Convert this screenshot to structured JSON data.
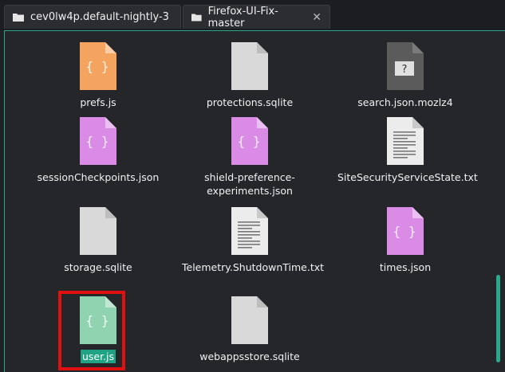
{
  "tabs": [
    {
      "label": "cev0lw4p.default-nightly-3",
      "active": true
    },
    {
      "label": "Firefox-UI-Fix-master",
      "active": false,
      "close": "✕"
    }
  ],
  "files": [
    {
      "name": "prefs.js",
      "type": "js-orange",
      "icon": "braces-file-icon"
    },
    {
      "name": "protections.sqlite",
      "type": "blank",
      "icon": "blank-file-icon"
    },
    {
      "name": "search.json.mozlz4",
      "type": "unknown",
      "icon": "unknown-file-icon"
    },
    {
      "name": "sessionCheckpoints.json",
      "type": "json-purple",
      "icon": "braces-file-icon"
    },
    {
      "name": "shield-preference-experiments.json",
      "type": "json-purple",
      "icon": "braces-file-icon"
    },
    {
      "name": "SiteSecurityServiceState.txt",
      "type": "text",
      "icon": "text-file-icon"
    },
    {
      "name": "storage.sqlite",
      "type": "blank",
      "icon": "blank-file-icon"
    },
    {
      "name": "Telemetry.ShutdownTime.txt",
      "type": "text",
      "icon": "text-file-icon"
    },
    {
      "name": "times.json",
      "type": "json-purple",
      "icon": "braces-file-icon"
    },
    {
      "name": "user.js",
      "type": "js-green",
      "icon": "braces-file-icon",
      "selected": true
    },
    {
      "name": "webappsstore.sqlite",
      "type": "blank",
      "icon": "blank-file-icon"
    }
  ],
  "colors": {
    "accent": "#1fa384",
    "selection_outline": "#e01010",
    "js_orange": "#f4a45f",
    "json_purple": "#d98be6",
    "js_green": "#8fd3b0"
  }
}
